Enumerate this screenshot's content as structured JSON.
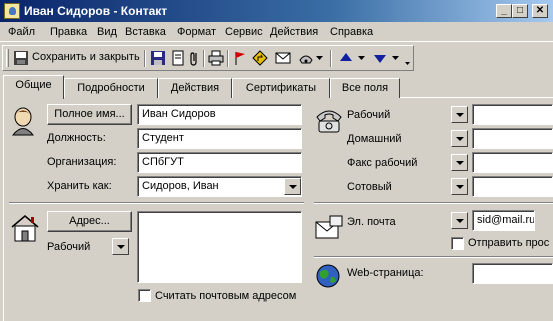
{
  "window": {
    "title": "Иван Сидоров - Контакт",
    "controls": [
      "_",
      "□",
      "✕"
    ]
  },
  "menu": [
    "Файл",
    "Правка",
    "Вид",
    "Вставка",
    "Формат",
    "Сервис",
    "Действия",
    "Справка"
  ],
  "toolbar": {
    "save_close_label": "Сохранить и закрыть"
  },
  "tabs": [
    "Общие",
    "Подробности",
    "Действия",
    "Сертификаты",
    "Все поля"
  ],
  "general": {
    "full_name_button": "Полное имя...",
    "full_name_value": "Иван Сидоров",
    "job_title_label": "Должность:",
    "job_title_value": "Студент",
    "company_label": "Организация:",
    "company_value": "СПбГУТ",
    "file_as_label": "Хранить как:",
    "file_as_value": "Сидоров, Иван",
    "address_button": "Адрес...",
    "address_type": "Рабочий",
    "address_value": "",
    "mailing_address_label": "Считать почтовым адресом"
  },
  "phones": [
    {
      "label": "Рабочий",
      "value": ""
    },
    {
      "label": "Домашний",
      "value": ""
    },
    {
      "label": "Факс рабочий",
      "value": ""
    },
    {
      "label": "Сотовый",
      "value": ""
    }
  ],
  "email": {
    "label": "Эл. почта",
    "value": "sid@mail.ru",
    "plain_text_label": "Отправить прос"
  },
  "web": {
    "label": "Web-страница:",
    "value": ""
  },
  "colors": {
    "title_start": "#0a246a",
    "title_end": "#a6caf0",
    "face": "#d4d0c8"
  }
}
